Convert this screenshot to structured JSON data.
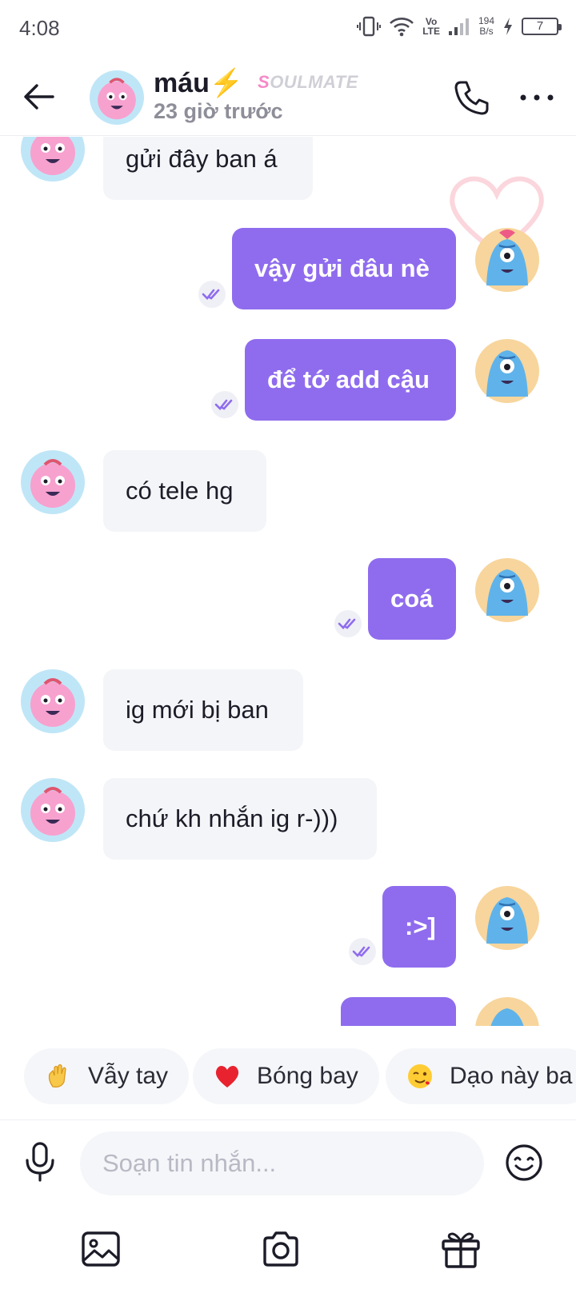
{
  "status_bar": {
    "time": "4:08",
    "volte_top": "Vo",
    "volte_bottom": "LTE",
    "speed_value": "194",
    "speed_unit": "B/s",
    "battery": "7"
  },
  "header": {
    "contact_name": "máu",
    "name_emoji": "⚡",
    "badge_first_letter": "S",
    "badge_rest": "OULMATE",
    "last_seen": "23 giờ trước"
  },
  "messages": [
    {
      "side": "in",
      "text": "gửi đây ban á"
    },
    {
      "side": "out",
      "text": "vậy gửi đâu nè"
    },
    {
      "side": "out",
      "text": "để tớ add cậu"
    },
    {
      "side": "in",
      "text": "có tele hg"
    },
    {
      "side": "out",
      "text": "coá"
    },
    {
      "side": "in",
      "text": "ig mới bị ban"
    },
    {
      "side": "in",
      "text": "chứ kh nhắn ig r-)))"
    },
    {
      "side": "out",
      "text": ":>]"
    }
  ],
  "quick_replies": [
    {
      "label": "Vẫy tay",
      "icon": "waving-hand-icon"
    },
    {
      "label": "Bóng bay",
      "icon": "red-heart-icon"
    },
    {
      "label": "Dạo này ba",
      "icon": "winking-face-icon"
    }
  ],
  "composer": {
    "placeholder": "Soạn tin nhắn...",
    "value": ""
  },
  "colors": {
    "accent": "#8f6cee",
    "incoming_bubble": "#f4f5f8",
    "soulmate_pink": "#f58ac7"
  }
}
